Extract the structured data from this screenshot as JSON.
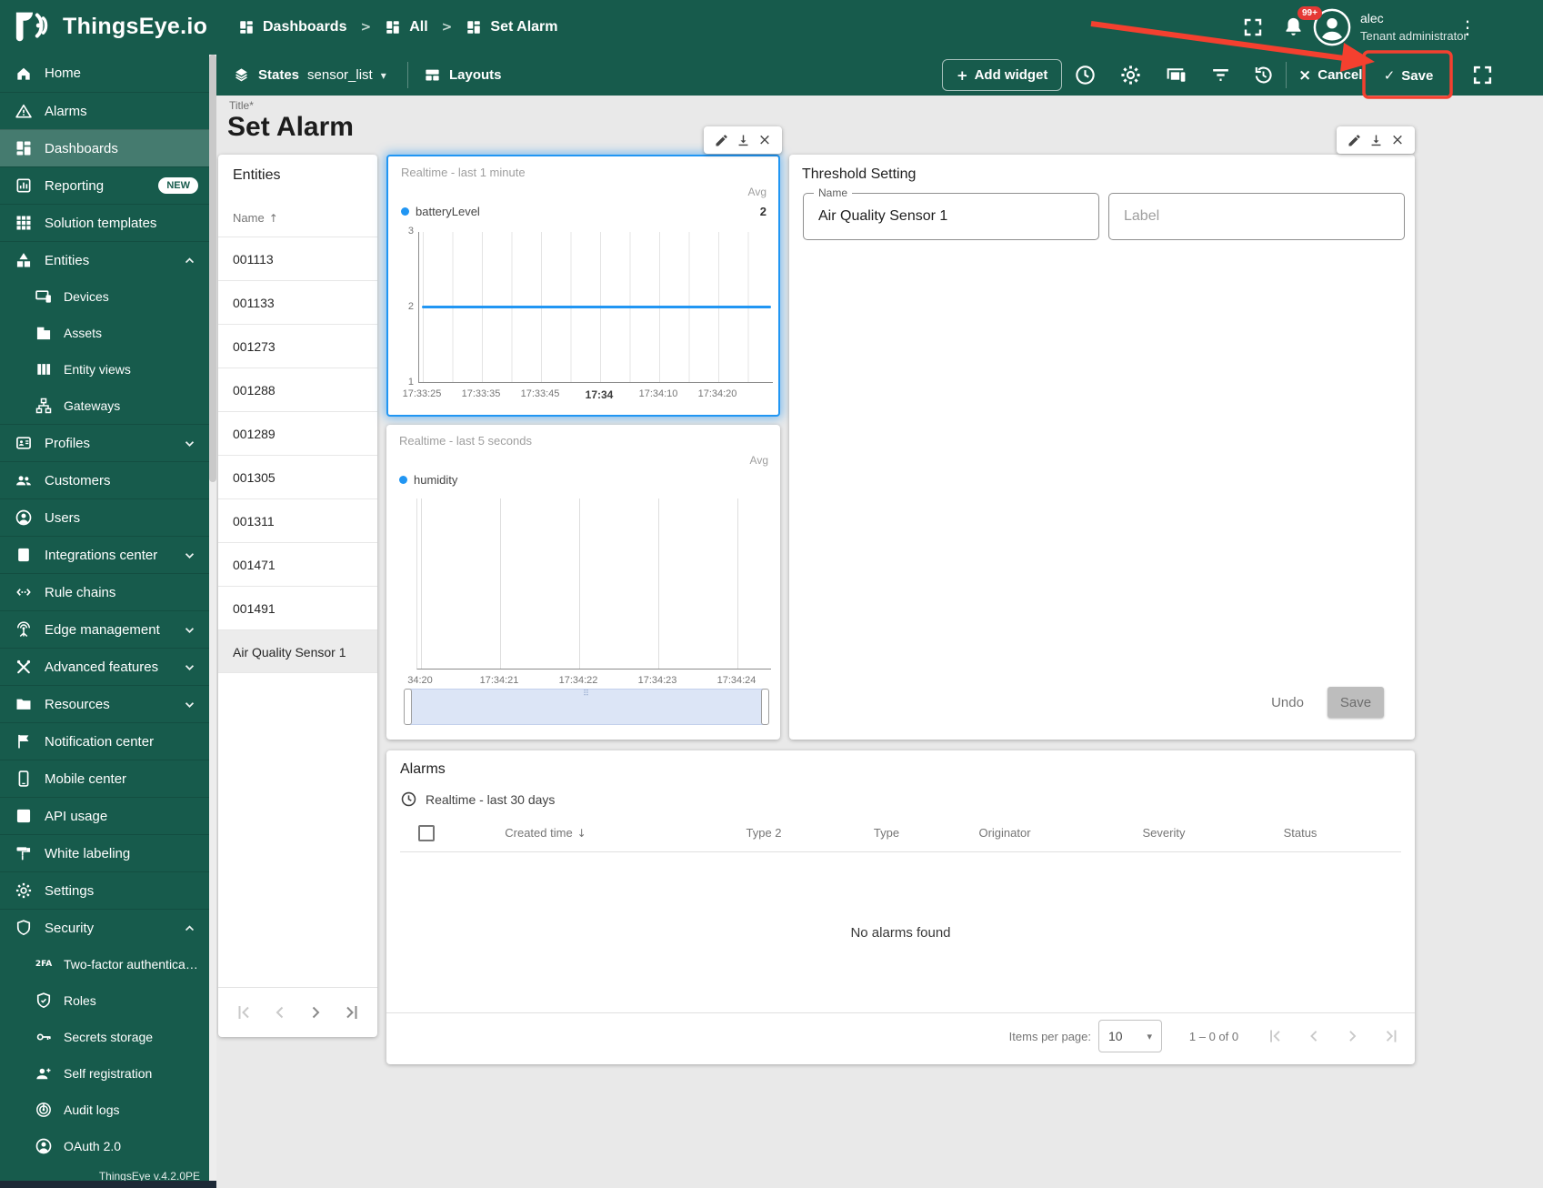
{
  "colors": {
    "brand_teal": "#175b4c",
    "annotation_red": "#f4402f",
    "series_blue": "#2196f3",
    "badge_red": "#e53935",
    "selected_border_blue": "#2196f3"
  },
  "header": {
    "logo_text": "ThingsEye.io",
    "breadcrumbs": [
      {
        "label": "Dashboards"
      },
      {
        "label": "All"
      },
      {
        "label": "Set Alarm"
      }
    ],
    "notifications_badge": "99+",
    "user": {
      "name": "alec",
      "role": "Tenant administrator"
    }
  },
  "toolbar": {
    "states_label": "States",
    "state_value": "sensor_list",
    "layouts_label": "Layouts",
    "add_widget_label": "Add widget",
    "cancel_label": "Cancel",
    "save_label": "Save"
  },
  "sidebar": {
    "version": "ThingsEye v.4.2.0PE",
    "items": [
      {
        "label": "Home",
        "icon": "home-icon"
      },
      {
        "label": "Alarms",
        "icon": "alarms-icon"
      },
      {
        "label": "Dashboards",
        "icon": "dashboards-icon",
        "active": true
      },
      {
        "label": "Reporting",
        "icon": "reporting-icon",
        "badge": "NEW"
      },
      {
        "label": "Solution templates",
        "icon": "solution-templates-icon"
      },
      {
        "label": "Entities",
        "icon": "entities-icon",
        "expanded": true,
        "children": [
          {
            "label": "Devices",
            "icon": "devices-icon"
          },
          {
            "label": "Assets",
            "icon": "assets-icon"
          },
          {
            "label": "Entity views",
            "icon": "entity-views-icon"
          },
          {
            "label": "Gateways",
            "icon": "gateways-icon"
          }
        ]
      },
      {
        "label": "Profiles",
        "icon": "profiles-icon",
        "expandable": true
      },
      {
        "label": "Customers",
        "icon": "customers-icon"
      },
      {
        "label": "Users",
        "icon": "users-icon"
      },
      {
        "label": "Integrations center",
        "icon": "integrations-center-icon",
        "expandable": true
      },
      {
        "label": "Rule chains",
        "icon": "rule-chains-icon"
      },
      {
        "label": "Edge management",
        "icon": "edge-management-icon",
        "expandable": true
      },
      {
        "label": "Advanced features",
        "icon": "advanced-features-icon",
        "expandable": true
      },
      {
        "label": "Resources",
        "icon": "resources-icon",
        "expandable": true
      },
      {
        "label": "Notification center",
        "icon": "notification-center-icon"
      },
      {
        "label": "Mobile center",
        "icon": "mobile-center-icon"
      },
      {
        "label": "API usage",
        "icon": "api-usage-icon"
      },
      {
        "label": "White labeling",
        "icon": "white-labeling-icon"
      },
      {
        "label": "Settings",
        "icon": "settings-icon"
      },
      {
        "label": "Security",
        "icon": "security-icon",
        "expanded": true,
        "children": [
          {
            "label": "Two-factor authenticati…",
            "icon": "two-factor-icon"
          },
          {
            "label": "Roles",
            "icon": "roles-icon"
          },
          {
            "label": "Secrets storage",
            "icon": "secrets-storage-icon"
          },
          {
            "label": "Self registration",
            "icon": "self-registration-icon"
          },
          {
            "label": "Audit logs",
            "icon": "audit-logs-icon"
          },
          {
            "label": "OAuth 2.0",
            "icon": "oauth-icon"
          }
        ]
      }
    ]
  },
  "dashboard": {
    "title_label": "Title*",
    "title": "Set Alarm",
    "entities_widget": {
      "title": "Entities",
      "name_column": "Name",
      "rows": [
        "001113",
        "001133",
        "001273",
        "001288",
        "001289",
        "001305",
        "001311",
        "001471",
        "001491",
        "Air Quality Sensor 1"
      ],
      "selected": "Air Quality Sensor 1"
    },
    "battery_widget": {
      "timewindow": "Realtime - last 1 minute",
      "aggregation": "Avg",
      "series_label": "batteryLevel",
      "series_value": "2",
      "emphasized_tick": "17:34",
      "chart_data": {
        "type": "line",
        "series": [
          {
            "name": "batteryLevel",
            "color": "#2196f3",
            "values": [
              2,
              2,
              2,
              2,
              2,
              2,
              2
            ],
            "avg": 2
          }
        ],
        "x_ticks": [
          "17:33:25",
          "17:33:35",
          "17:33:45",
          "17:34",
          "17:34:10",
          "17:34:20"
        ],
        "y_ticks": [
          "3",
          "2",
          "1"
        ],
        "ylim": [
          1,
          3
        ],
        "grid": true,
        "legend_position": "top"
      }
    },
    "humidity_widget": {
      "timewindow": "Realtime - last 5 seconds",
      "aggregation": "Avg",
      "series_label": "humidity",
      "chart_data": {
        "type": "line",
        "series": [
          {
            "name": "humidity",
            "color": "#2196f3",
            "values": []
          }
        ],
        "x_ticks": [
          "34:20",
          "17:34:21",
          "17:34:22",
          "17:34:23",
          "17:34:24"
        ],
        "grid": true,
        "legend_position": "top"
      }
    },
    "threshold_widget": {
      "title": "Threshold Setting",
      "name_label": "Name",
      "name_value": "Air Quality Sensor 1",
      "label_placeholder": "Label",
      "undo_label": "Undo",
      "save_label": "Save"
    },
    "alarms_widget": {
      "title": "Alarms",
      "timewindow": "Realtime - last 30 days",
      "columns": [
        "Created time",
        "Type 2",
        "Type",
        "Originator",
        "Severity",
        "Status"
      ],
      "sorted_column": "Created time",
      "empty_message": "No alarms found",
      "items_per_page_label": "Items per page:",
      "items_per_page_value": "10",
      "range_label": "1 – 0 of 0"
    }
  }
}
